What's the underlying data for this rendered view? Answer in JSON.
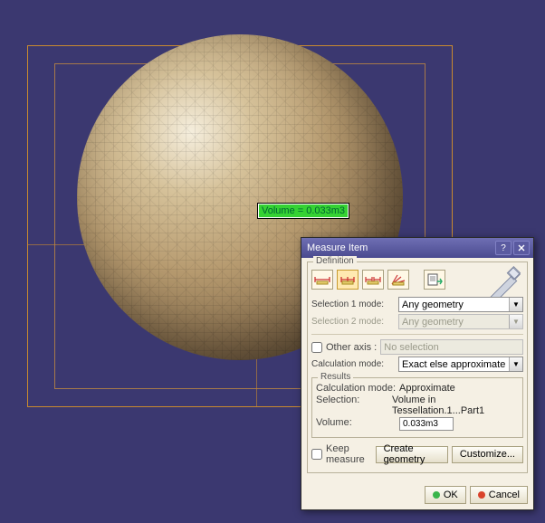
{
  "viewport": {
    "measure_label": "Volume = 0.033m3"
  },
  "dialog": {
    "title": "Measure Item",
    "sections": {
      "definition": "Definition",
      "results": "Results"
    },
    "labels": {
      "selection1_mode": "Selection 1 mode:",
      "selection2_mode": "Selection 2 mode:",
      "other_axis": "Other axis :",
      "calculation_mode": "Calculation mode:",
      "calc_mode_result": "Calculation mode:",
      "selection_result": "Selection:",
      "volume_result": "Volume:",
      "keep_measure": "Keep measure"
    },
    "values": {
      "selection1_mode": "Any geometry",
      "selection2_mode": "Any geometry",
      "other_axis_placeholder": "No selection",
      "calculation_mode": "Exact else approximate",
      "calc_mode_result": "Approximate",
      "selection_result": "Volume in Tessellation.1...Part1",
      "volume_result": "0.033m3"
    },
    "buttons": {
      "create_geometry": "Create geometry",
      "customize": "Customize...",
      "ok": "OK",
      "cancel": "Cancel"
    },
    "checks": {
      "other_axis": false,
      "keep_measure": false
    }
  }
}
